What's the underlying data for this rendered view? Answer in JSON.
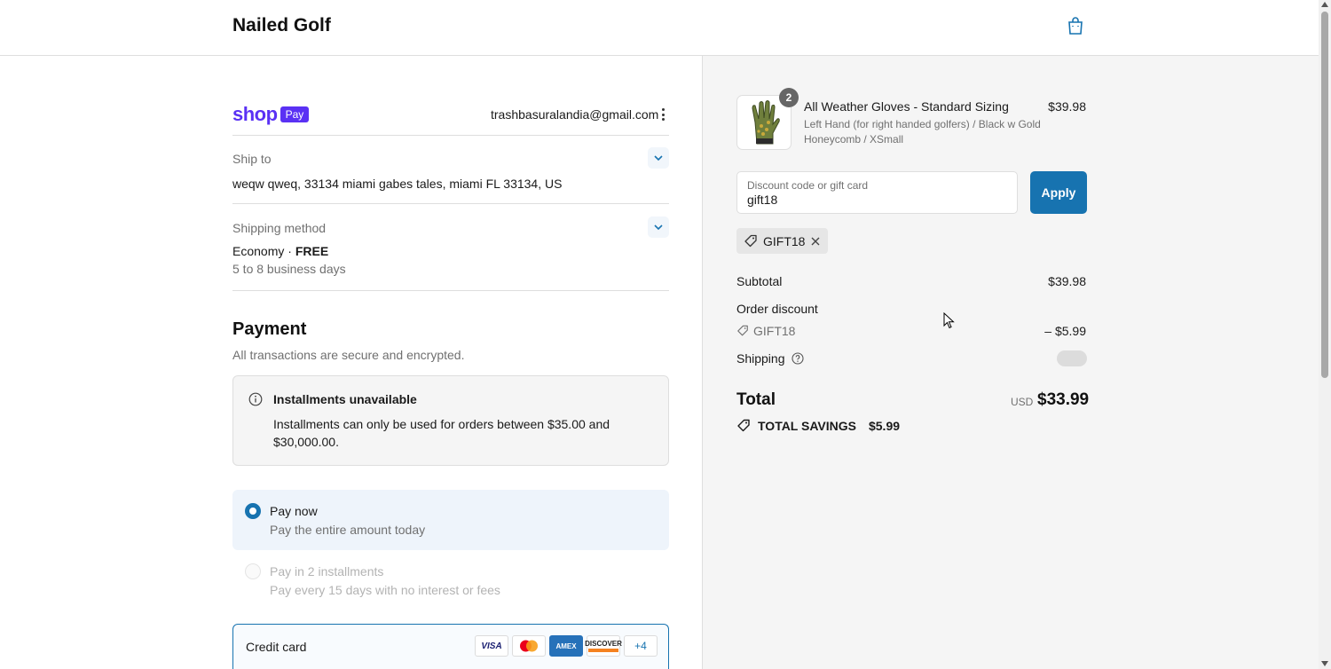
{
  "header": {
    "store_name": "Nailed Golf",
    "cart_icon": "shopping-bag-icon"
  },
  "express": {
    "shop_word": "shop",
    "shop_badge": "Pay",
    "email": "trashbasuralandia@gmail.com",
    "menu_icon": "kebab-menu-icon"
  },
  "ship_to": {
    "label": "Ship to",
    "value": "weqw qweq, 33134 miami gabes tales, miami FL 33134, US"
  },
  "shipping_method": {
    "label": "Shipping method",
    "name": "Economy",
    "separator": " · ",
    "price": "FREE",
    "eta": "5 to 8 business days"
  },
  "payment": {
    "title": "Payment",
    "subtitle": "All transactions are secure and encrypted.",
    "notice": {
      "title": "Installments unavailable",
      "body": "Installments can only be used for orders between $35.00 and $30,000.00.",
      "icon": "info-icon"
    },
    "options": [
      {
        "title": "Pay now",
        "subtitle": "Pay the entire amount today",
        "selected": true
      },
      {
        "title": "Pay in 2 installments",
        "subtitle": "Pay every 15 days with no interest or fees",
        "selected": false
      }
    ],
    "credit_card": {
      "label": "Credit card",
      "cards": [
        "VISA",
        "MC",
        "AMEX",
        "DISCOVER"
      ],
      "more": "+4"
    }
  },
  "summary": {
    "item": {
      "name": "All Weather Gloves - Standard Sizing",
      "variant": "Left Hand (for right handed golfers) / Black w Gold Honeycomb / XSmall",
      "price": "$39.98",
      "quantity": "2"
    },
    "discount_field": {
      "placeholder": "Discount code or gift card",
      "value": "gift18"
    },
    "apply_label": "Apply",
    "applied_code": "GIFT18",
    "subtotal_label": "Subtotal",
    "subtotal_value": "$39.98",
    "order_discount_label": "Order discount",
    "order_discount_code": "GIFT18",
    "order_discount_value": "– $5.99",
    "shipping_label": "Shipping",
    "total_label": "Total",
    "currency": "USD",
    "total_value": "$33.99",
    "savings_label": "TOTAL SAVINGS",
    "savings_value": "$5.99"
  },
  "colors": {
    "accent": "#1773b0",
    "shop_pay": "#5a31f4",
    "summary_bg": "#f5f5f5"
  }
}
